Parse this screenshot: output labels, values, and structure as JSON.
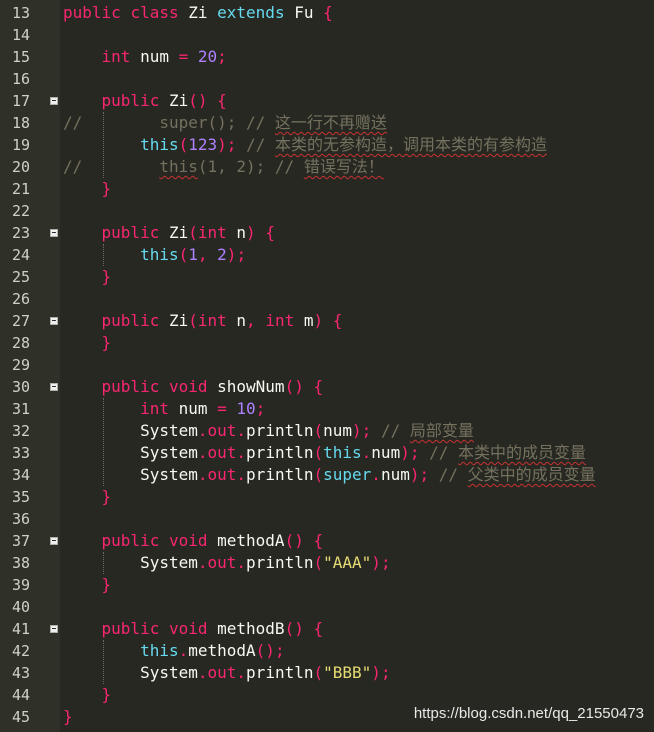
{
  "editor": {
    "language": "Java",
    "theme_colors": {
      "background": "#272822",
      "gutter": "#2f3129",
      "keyword": "#f92672",
      "type": "#66d9ef",
      "class_name": "#a6e22e",
      "number": "#ae81ff",
      "string": "#e6db74",
      "comment": "#75715e"
    },
    "lines": [
      {
        "no": "13",
        "fold": false,
        "tokens": [
          [
            "kw",
            "public"
          ],
          [
            "p",
            " "
          ],
          [
            "kw",
            "class"
          ],
          [
            "p",
            " Zi "
          ],
          [
            "type",
            "extends"
          ],
          [
            "p",
            " Fu "
          ],
          [
            "op",
            "{"
          ]
        ]
      },
      {
        "no": "14",
        "fold": false,
        "tokens": []
      },
      {
        "no": "15",
        "fold": false,
        "tokens": [
          [
            "p",
            "    "
          ],
          [
            "kw",
            "int"
          ],
          [
            "p",
            " num "
          ],
          [
            "op",
            "="
          ],
          [
            "p",
            " "
          ],
          [
            "num",
            "20"
          ],
          [
            "op",
            ";"
          ]
        ]
      },
      {
        "no": "16",
        "fold": false,
        "tokens": []
      },
      {
        "no": "17",
        "fold": true,
        "tokens": [
          [
            "p",
            "    "
          ],
          [
            "kw",
            "public"
          ],
          [
            "p",
            " Zi"
          ],
          [
            "op",
            "()"
          ],
          [
            "p",
            " "
          ],
          [
            "op",
            "{"
          ]
        ]
      },
      {
        "no": "18",
        "fold": false,
        "tokens": [
          [
            "com",
            "//        super(); // "
          ],
          [
            "comu",
            "这一行不再赠送"
          ]
        ]
      },
      {
        "no": "19",
        "fold": false,
        "tokens": [
          [
            "p",
            "        "
          ],
          [
            "type",
            "this"
          ],
          [
            "op",
            "("
          ],
          [
            "num",
            "123"
          ],
          [
            "op",
            ")"
          ],
          [
            "op",
            ";"
          ],
          [
            "p",
            " "
          ],
          [
            "com",
            "// "
          ],
          [
            "comu",
            "本类的无参构造，调用本类的有参构造"
          ]
        ]
      },
      {
        "no": "20",
        "fold": false,
        "tokens": [
          [
            "com",
            "//        "
          ],
          [
            "comu",
            "this"
          ],
          [
            "com",
            "(1, 2); // "
          ],
          [
            "comu",
            "错误写法！"
          ]
        ]
      },
      {
        "no": "21",
        "fold": false,
        "tokens": [
          [
            "p",
            "    "
          ],
          [
            "op",
            "}"
          ]
        ]
      },
      {
        "no": "22",
        "fold": false,
        "tokens": []
      },
      {
        "no": "23",
        "fold": true,
        "tokens": [
          [
            "p",
            "    "
          ],
          [
            "kw",
            "public"
          ],
          [
            "p",
            " Zi"
          ],
          [
            "op",
            "("
          ],
          [
            "kw",
            "int"
          ],
          [
            "p",
            " n"
          ],
          [
            "op",
            ")"
          ],
          [
            "p",
            " "
          ],
          [
            "op",
            "{"
          ]
        ]
      },
      {
        "no": "24",
        "fold": false,
        "tokens": [
          [
            "p",
            "        "
          ],
          [
            "type",
            "this"
          ],
          [
            "op",
            "("
          ],
          [
            "num",
            "1"
          ],
          [
            "op",
            ","
          ],
          [
            "p",
            " "
          ],
          [
            "num",
            "2"
          ],
          [
            "op",
            ")"
          ],
          [
            "op",
            ";"
          ]
        ]
      },
      {
        "no": "25",
        "fold": false,
        "tokens": [
          [
            "p",
            "    "
          ],
          [
            "op",
            "}"
          ]
        ]
      },
      {
        "no": "26",
        "fold": false,
        "tokens": []
      },
      {
        "no": "27",
        "fold": true,
        "tokens": [
          [
            "p",
            "    "
          ],
          [
            "kw",
            "public"
          ],
          [
            "p",
            " Zi"
          ],
          [
            "op",
            "("
          ],
          [
            "kw",
            "int"
          ],
          [
            "p",
            " n"
          ],
          [
            "op",
            ","
          ],
          [
            "p",
            " "
          ],
          [
            "kw",
            "int"
          ],
          [
            "p",
            " m"
          ],
          [
            "op",
            ")"
          ],
          [
            "p",
            " "
          ],
          [
            "op",
            "{"
          ]
        ]
      },
      {
        "no": "28",
        "fold": false,
        "tokens": [
          [
            "p",
            "    "
          ],
          [
            "op",
            "}"
          ]
        ]
      },
      {
        "no": "29",
        "fold": false,
        "tokens": []
      },
      {
        "no": "30",
        "fold": true,
        "tokens": [
          [
            "p",
            "    "
          ],
          [
            "kw",
            "public"
          ],
          [
            "p",
            " "
          ],
          [
            "kw",
            "void"
          ],
          [
            "p",
            " showNum"
          ],
          [
            "op",
            "()"
          ],
          [
            "p",
            " "
          ],
          [
            "op",
            "{"
          ]
        ]
      },
      {
        "no": "31",
        "fold": false,
        "tokens": [
          [
            "p",
            "        "
          ],
          [
            "kw",
            "int"
          ],
          [
            "p",
            " num "
          ],
          [
            "op",
            "="
          ],
          [
            "p",
            " "
          ],
          [
            "num",
            "10"
          ],
          [
            "op",
            ";"
          ]
        ]
      },
      {
        "no": "32",
        "fold": false,
        "tokens": [
          [
            "p",
            "        System"
          ],
          [
            "op",
            "."
          ],
          [
            "kw",
            "out"
          ],
          [
            "op",
            "."
          ],
          [
            "p",
            "println"
          ],
          [
            "op",
            "("
          ],
          [
            "p",
            "num"
          ],
          [
            "op",
            ")"
          ],
          [
            "op",
            ";"
          ],
          [
            "p",
            " "
          ],
          [
            "com",
            "// "
          ],
          [
            "comu",
            "局部变量"
          ]
        ]
      },
      {
        "no": "33",
        "fold": false,
        "tokens": [
          [
            "p",
            "        System"
          ],
          [
            "op",
            "."
          ],
          [
            "kw",
            "out"
          ],
          [
            "op",
            "."
          ],
          [
            "p",
            "println"
          ],
          [
            "op",
            "("
          ],
          [
            "type",
            "this"
          ],
          [
            "op",
            "."
          ],
          [
            "p",
            "num"
          ],
          [
            "op",
            ")"
          ],
          [
            "op",
            ";"
          ],
          [
            "p",
            " "
          ],
          [
            "com",
            "// "
          ],
          [
            "comu",
            "本类中的成员变量"
          ]
        ]
      },
      {
        "no": "34",
        "fold": false,
        "tokens": [
          [
            "p",
            "        System"
          ],
          [
            "op",
            "."
          ],
          [
            "kw",
            "out"
          ],
          [
            "op",
            "."
          ],
          [
            "p",
            "println"
          ],
          [
            "op",
            "("
          ],
          [
            "type",
            "super"
          ],
          [
            "op",
            "."
          ],
          [
            "p",
            "num"
          ],
          [
            "op",
            ")"
          ],
          [
            "op",
            ";"
          ],
          [
            "p",
            " "
          ],
          [
            "com",
            "// "
          ],
          [
            "comu",
            "父类中的成员变量"
          ]
        ]
      },
      {
        "no": "35",
        "fold": false,
        "tokens": [
          [
            "p",
            "    "
          ],
          [
            "op",
            "}"
          ]
        ]
      },
      {
        "no": "36",
        "fold": false,
        "tokens": []
      },
      {
        "no": "37",
        "fold": true,
        "tokens": [
          [
            "p",
            "    "
          ],
          [
            "kw",
            "public"
          ],
          [
            "p",
            " "
          ],
          [
            "kw",
            "void"
          ],
          [
            "p",
            " methodA"
          ],
          [
            "op",
            "()"
          ],
          [
            "p",
            " "
          ],
          [
            "op",
            "{"
          ]
        ]
      },
      {
        "no": "38",
        "fold": false,
        "tokens": [
          [
            "p",
            "        System"
          ],
          [
            "op",
            "."
          ],
          [
            "kw",
            "out"
          ],
          [
            "op",
            "."
          ],
          [
            "p",
            "println"
          ],
          [
            "op",
            "("
          ],
          [
            "str",
            "\"AAA\""
          ],
          [
            "op",
            ")"
          ],
          [
            "op",
            ";"
          ]
        ]
      },
      {
        "no": "39",
        "fold": false,
        "tokens": [
          [
            "p",
            "    "
          ],
          [
            "op",
            "}"
          ]
        ]
      },
      {
        "no": "40",
        "fold": false,
        "tokens": []
      },
      {
        "no": "41",
        "fold": true,
        "tokens": [
          [
            "p",
            "    "
          ],
          [
            "kw",
            "public"
          ],
          [
            "p",
            " "
          ],
          [
            "kw",
            "void"
          ],
          [
            "p",
            " methodB"
          ],
          [
            "op",
            "()"
          ],
          [
            "p",
            " "
          ],
          [
            "op",
            "{"
          ]
        ]
      },
      {
        "no": "42",
        "fold": false,
        "tokens": [
          [
            "p",
            "        "
          ],
          [
            "type",
            "this"
          ],
          [
            "op",
            "."
          ],
          [
            "p",
            "methodA"
          ],
          [
            "op",
            "()"
          ],
          [
            "op",
            ";"
          ]
        ]
      },
      {
        "no": "43",
        "fold": false,
        "tokens": [
          [
            "p",
            "        System"
          ],
          [
            "op",
            "."
          ],
          [
            "kw",
            "out"
          ],
          [
            "op",
            "."
          ],
          [
            "p",
            "println"
          ],
          [
            "op",
            "("
          ],
          [
            "str",
            "\"BBB\""
          ],
          [
            "op",
            ")"
          ],
          [
            "op",
            ";"
          ]
        ]
      },
      {
        "no": "44",
        "fold": false,
        "tokens": [
          [
            "p",
            "    "
          ],
          [
            "op",
            "}"
          ]
        ]
      },
      {
        "no": "45",
        "fold": false,
        "tokens": [
          [
            "op",
            "}"
          ]
        ]
      }
    ]
  },
  "watermark": "https://blog.csdn.net/qq_21550473"
}
